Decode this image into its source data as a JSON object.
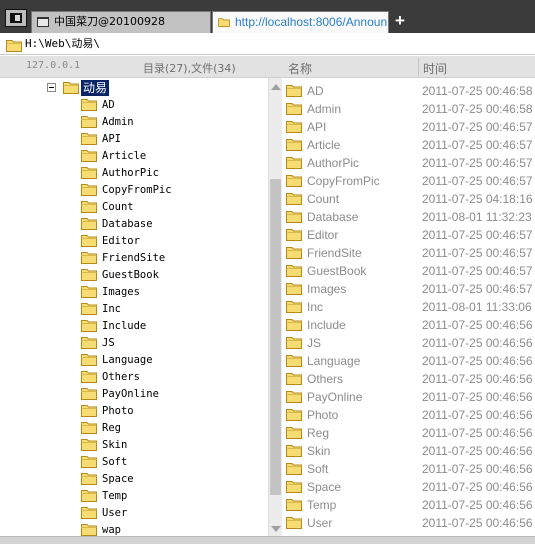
{
  "tabs": [
    {
      "label": "中国菜刀@20100928",
      "active": false
    },
    {
      "label": "http://localhost:8006/Announ...",
      "active": true
    }
  ],
  "new_tab_label": "+",
  "address": {
    "path": "H:\\Web\\动易\\"
  },
  "status": {
    "ip": "127.0.0.1",
    "counts": "目录(27),文件(34)"
  },
  "columns": {
    "name": "名称",
    "time": "时间"
  },
  "tree": {
    "root": "动易",
    "items": [
      "AD",
      "Admin",
      "API",
      "Article",
      "AuthorPic",
      "CopyFromPic",
      "Count",
      "Database",
      "Editor",
      "FriendSite",
      "GuestBook",
      "Images",
      "Inc",
      "Include",
      "JS",
      "Language",
      "Others",
      "PayOnline",
      "Photo",
      "Reg",
      "Skin",
      "Soft",
      "Space",
      "Temp",
      "User",
      "wap"
    ]
  },
  "list": [
    {
      "name": "AD",
      "time": "2011-07-25 00:46:58"
    },
    {
      "name": "Admin",
      "time": "2011-07-25 00:46:58"
    },
    {
      "name": "API",
      "time": "2011-07-25 00:46:57"
    },
    {
      "name": "Article",
      "time": "2011-07-25 00:46:57"
    },
    {
      "name": "AuthorPic",
      "time": "2011-07-25 00:46:57"
    },
    {
      "name": "CopyFromPic",
      "time": "2011-07-25 00:46:57"
    },
    {
      "name": "Count",
      "time": "2011-07-25 04:18:16"
    },
    {
      "name": "Database",
      "time": "2011-08-01 11:32:23"
    },
    {
      "name": "Editor",
      "time": "2011-07-25 00:46:57"
    },
    {
      "name": "FriendSite",
      "time": "2011-07-25 00:46:57"
    },
    {
      "name": "GuestBook",
      "time": "2011-07-25 00:46:57"
    },
    {
      "name": "Images",
      "time": "2011-07-25 00:46:57"
    },
    {
      "name": "Inc",
      "time": "2011-08-01 11:33:06"
    },
    {
      "name": "Include",
      "time": "2011-07-25 00:46:56"
    },
    {
      "name": "JS",
      "time": "2011-07-25 00:46:56"
    },
    {
      "name": "Language",
      "time": "2011-07-25 00:46:56"
    },
    {
      "name": "Others",
      "time": "2011-07-25 00:46:56"
    },
    {
      "name": "PayOnline",
      "time": "2011-07-25 00:46:56"
    },
    {
      "name": "Photo",
      "time": "2011-07-25 00:46:56"
    },
    {
      "name": "Reg",
      "time": "2011-07-25 00:46:56"
    },
    {
      "name": "Skin",
      "time": "2011-07-25 00:46:56"
    },
    {
      "name": "Soft",
      "time": "2011-07-25 00:46:56"
    },
    {
      "name": "Space",
      "time": "2011-07-25 00:46:56"
    },
    {
      "name": "Temp",
      "time": "2011-07-25 00:46:56"
    },
    {
      "name": "User",
      "time": "2011-07-25 00:46:56"
    }
  ],
  "icons": {
    "folder": "folder-icon",
    "sidebar": "sidebar-toggle-icon",
    "page": "page-icon",
    "globe": "browser-tab-icon"
  },
  "colors": {
    "folder_fill": "#f6dc72",
    "folder_stroke": "#b68a1a",
    "selection": "#0a246a",
    "link": "#2c7fc8"
  }
}
